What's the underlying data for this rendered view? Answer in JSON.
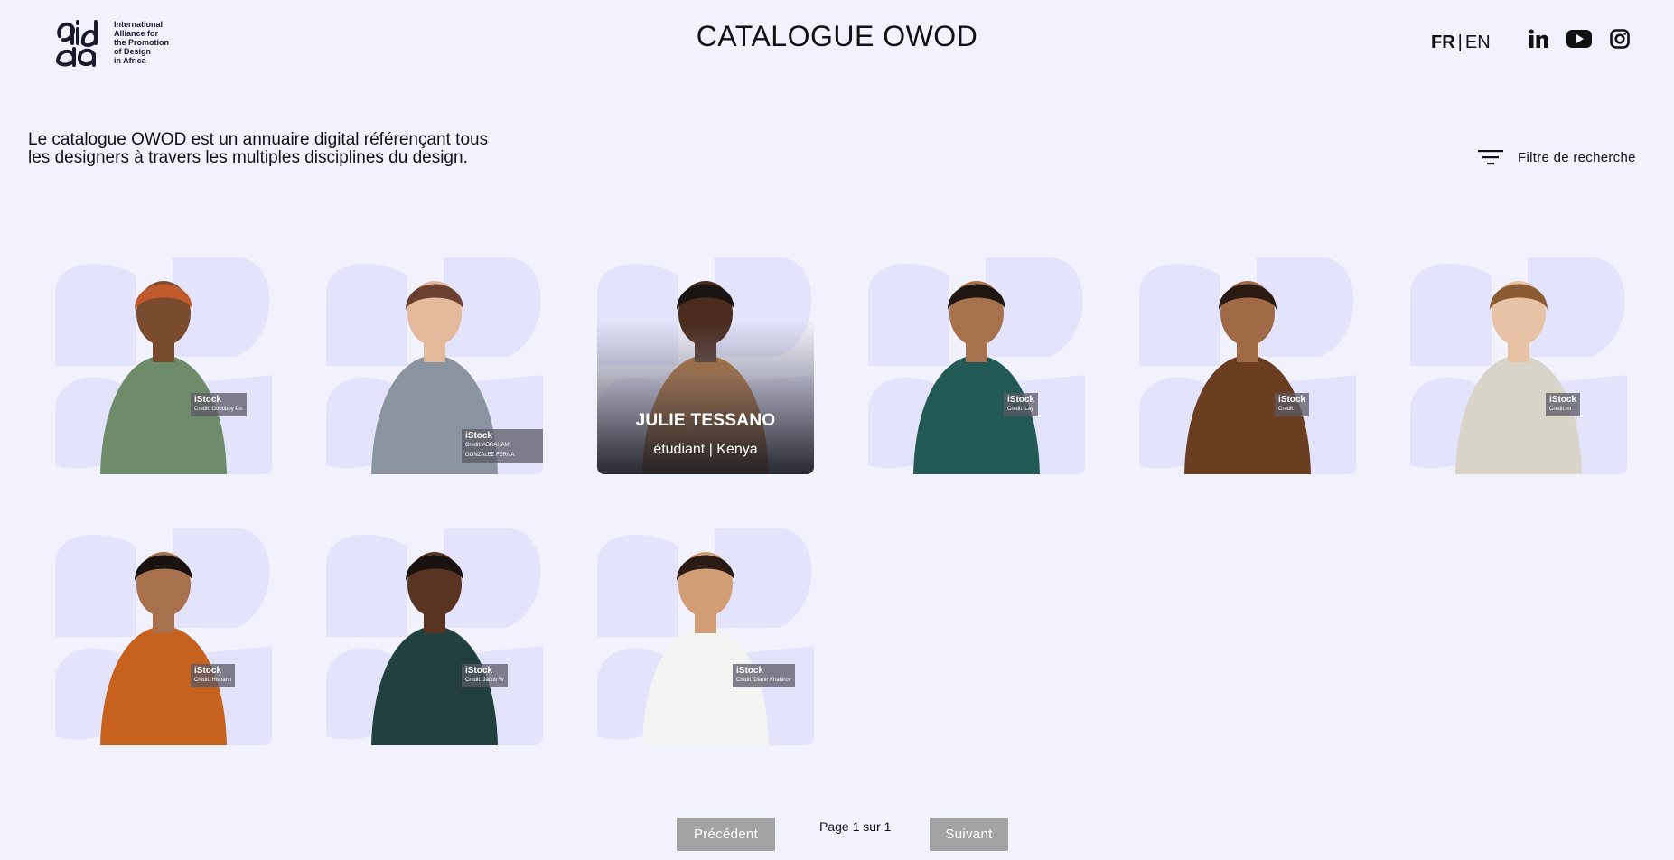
{
  "header": {
    "logo_name": "aida-logo",
    "logo_text": [
      "International",
      "Alliance for",
      "the Promotion",
      "of Design",
      "in Africa"
    ],
    "title": "CATALOGUE OWOD",
    "lang_fr": "FR",
    "lang_sep": "|",
    "lang_en": "EN",
    "social_icons": [
      "linkedin-icon",
      "youtube-icon",
      "instagram-icon"
    ]
  },
  "intro": {
    "text": "Le catalogue OWOD est un annuaire digital référençant tous les designers à travers les multiples disciplines du design."
  },
  "filter": {
    "label": "Filtre de recherche",
    "icon": "filter-icon"
  },
  "cards": [
    {
      "istock": "iStock",
      "credit": "Credit: Goodboy Pic",
      "shirt": "#6f8c6a",
      "skin": "#7a4b2f",
      "hair": "#c0592c"
    },
    {
      "istock": "iStock",
      "credit": "Credit: ABRAHAM GONZALEZ FERNA",
      "shirt": "#8a94a0",
      "skin": "#e4b89a",
      "hair": "#6b4030"
    },
    {
      "istock": "",
      "credit": "",
      "shirt": "#b0661c",
      "skin": "#4a2b1c",
      "hair": "#1a1412",
      "name": "JULIE TESSANO",
      "role": "étudiant | Kenya"
    },
    {
      "istock": "iStock",
      "credit": "Credit: Lay",
      "shirt": "#245a56",
      "skin": "#a8714e",
      "hair": "#201610"
    },
    {
      "istock": "iStock",
      "credit": "Credit:",
      "shirt": "#6b3e22",
      "skin": "#a06a46",
      "hair": "#2a1a12"
    },
    {
      "istock": "iStock",
      "credit": "Credit: m",
      "shirt": "#d8d4c8",
      "skin": "#e8c2a4",
      "hair": "#8a5a30"
    },
    {
      "istock": "iStock",
      "credit": "Credit: Hispano",
      "shirt": "#c6621e",
      "skin": "#a8704c",
      "hair": "#1a1210"
    },
    {
      "istock": "iStock",
      "credit": "Credit: Jacob W",
      "shirt": "#21403f",
      "skin": "#5a3422",
      "hair": "#1a1210"
    },
    {
      "istock": "iStock",
      "credit": "Credit: Damir Khabirov",
      "shirt": "#f4f4f2",
      "skin": "#d29c74",
      "hair": "#2a1c14"
    }
  ],
  "pagination": {
    "prev_label": "Précédent",
    "page_info": "Page 1 sur 1",
    "next_label": "Suivant"
  }
}
